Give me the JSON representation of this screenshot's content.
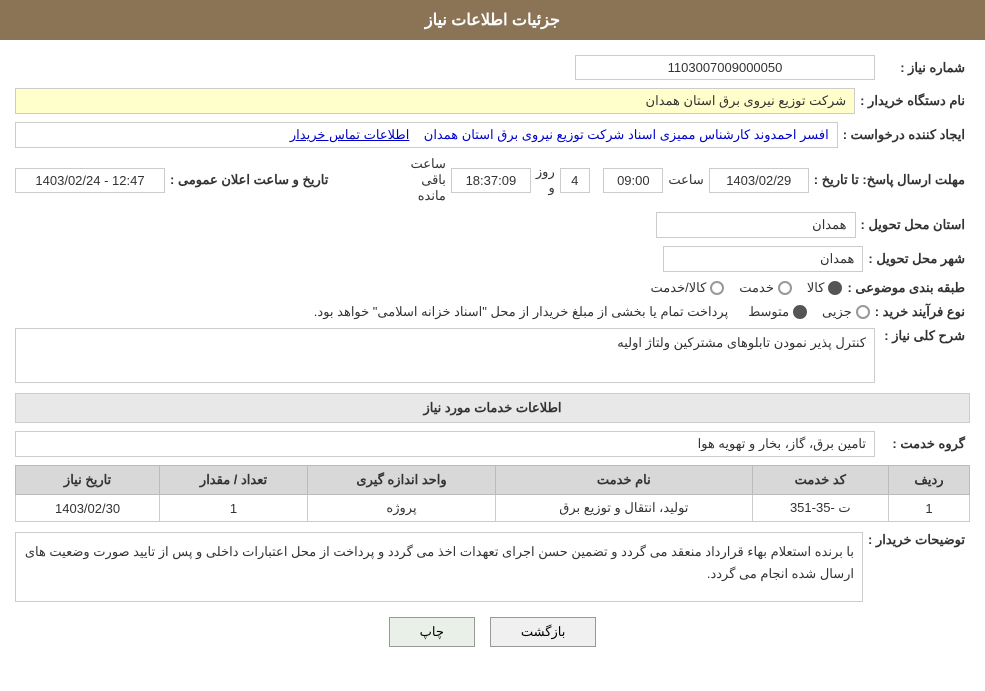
{
  "header": {
    "title": "جزئیات اطلاعات نیاز"
  },
  "fields": {
    "need_number_label": "شماره نیاز :",
    "need_number_value": "1103007009000050",
    "buyer_name_label": "نام دستگاه خریدار :",
    "buyer_name_value": "شرکت توزیع نیروی برق استان همدان",
    "creator_label": "ایجاد کننده درخواست :",
    "creator_value": "افسر احمدوند کارشناس ممیزی اسناد شرکت توزیع نیروی برق استان همدان",
    "creator_link": "اطلاعات تماس خریدار",
    "deadline_label": "مهلت ارسال پاسخ: تا تاریخ :",
    "deadline_date": "1403/02/29",
    "deadline_time": "09:00",
    "deadline_days": "4",
    "deadline_remaining": "18:37:09",
    "deadline_time_label": "ساعت",
    "deadline_days_label": "روز و",
    "deadline_remaining_label": "ساعت باقی مانده",
    "announce_label": "تاریخ و ساعت اعلان عمومی :",
    "announce_value": "1403/02/24 - 12:47",
    "province_label": "استان محل تحویل :",
    "province_value": "همدان",
    "city_label": "شهر محل تحویل :",
    "city_value": "همدان",
    "category_label": "طبقه بندی موضوعی :",
    "category_options": [
      "کالا",
      "خدمت",
      "کالا/خدمت"
    ],
    "category_selected": "کالا",
    "purchase_type_label": "نوع فرآیند خرید :",
    "purchase_type_options": [
      "جزیی",
      "متوسط"
    ],
    "purchase_type_selected": "متوسط",
    "purchase_type_note": "پرداخت تمام یا بخشی از مبلغ خریدار از محل \"اسناد خزانه اسلامی\" خواهد بود.",
    "need_desc_label": "شرح کلی نیاز :",
    "need_desc_value": "کنترل پذیر نمودن تابلوهای مشترکین ولتاژ اولیه",
    "services_section_title": "اطلاعات خدمات مورد نیاز",
    "service_group_label": "گروه خدمت :",
    "service_group_value": "تامین برق، گاز، بخار و تهویه هوا",
    "table": {
      "columns": [
        "ردیف",
        "کد خدمت",
        "نام خدمت",
        "واحد اندازه گیری",
        "تعداد / مقدار",
        "تاریخ نیاز"
      ],
      "rows": [
        {
          "row_num": "1",
          "service_code": "ت -35-351",
          "service_name": "تولید، انتقال و توزیع برق",
          "unit": "پروژه",
          "quantity": "1",
          "date": "1403/02/30"
        }
      ]
    },
    "buyer_notes_label": "توضیحات خریدار :",
    "buyer_notes_value": "با برنده استعلام بهاء قرارداد منعقد می گردد و تضمین حسن اجرای تعهدات اخذ می گردد و پرداخت از محل اعتبارات داخلی و پس از تایید صورت وضعیت های ارسال شده انجام می گردد.",
    "btn_back": "بازگشت",
    "btn_print": "چاپ"
  }
}
